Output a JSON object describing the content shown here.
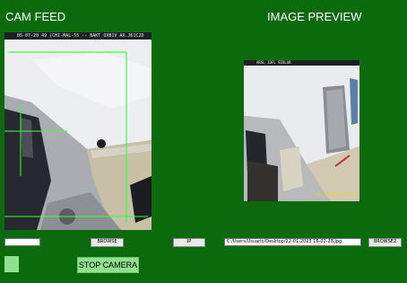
{
  "window": {
    "cam_title": "CAM FEED",
    "preview_title": "IMAGE PREVIEW",
    "background_color": "#0b6a0b"
  },
  "cam_feed": {
    "osd_text": "05-07-20 49   (CHI-MAL-55 -- BAKT OXB1V AX.J61C2D",
    "overlay_color": "#3cff3c"
  },
  "preview": {
    "osd_text": "ARSL JDFL SIOLOR",
    "timestamp": "7/3/1/2023 16:02"
  },
  "controls": {
    "path_entry_value": "",
    "browse_label": "BROWSE",
    "ip_label": "IP",
    "save_path_value": "C:/Users/Usuario/Desktop/22-01-2023 16-02-28.jpg",
    "browse2_label": "BROWSE2",
    "stop_camera_label": "STOP CAMERA",
    "indicator_color": "#8fe08f"
  }
}
